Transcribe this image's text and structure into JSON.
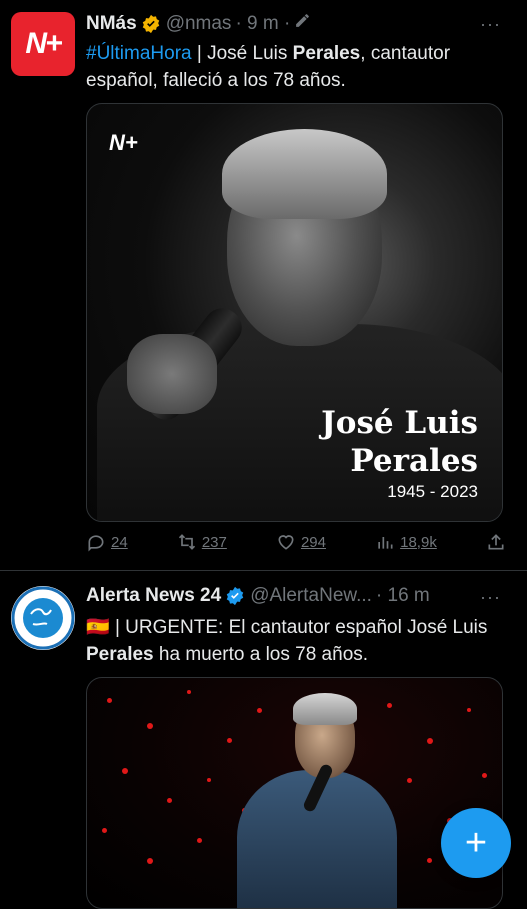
{
  "tweets": [
    {
      "author": "NMás",
      "avatar_text": "N+",
      "handle": "@nmas",
      "time": "· 9 m ·",
      "more": "···",
      "hashtag": "#ÚltimaHora",
      "text_part1": " | José Luis ",
      "text_bold": "Perales",
      "text_part2": ", cantautor español, falleció a los 78 años.",
      "media": {
        "logo": "N+",
        "name_line1": "José Luis",
        "name_line2": "Perales",
        "years": "1945 - 2023"
      },
      "actions": {
        "replies": "24",
        "retweets": "237",
        "likes": "294",
        "views": "18,9k"
      }
    },
    {
      "author": "Alerta News 24",
      "handle": "@AlertaNew...",
      "time": "· 16 m",
      "more": "···",
      "flag": "🇪🇸",
      "text_part1": " | URGENTE: El cantautor español José Luis ",
      "text_bold": "Perales",
      "text_part2": " ha muerto a los 78 años."
    }
  ],
  "fab": {
    "label": "+"
  },
  "colors": {
    "accent": "#1d9bf0",
    "verified": "#f4b400",
    "verified_blue": "#1d9bf0",
    "nmas_red": "#e8232d"
  }
}
